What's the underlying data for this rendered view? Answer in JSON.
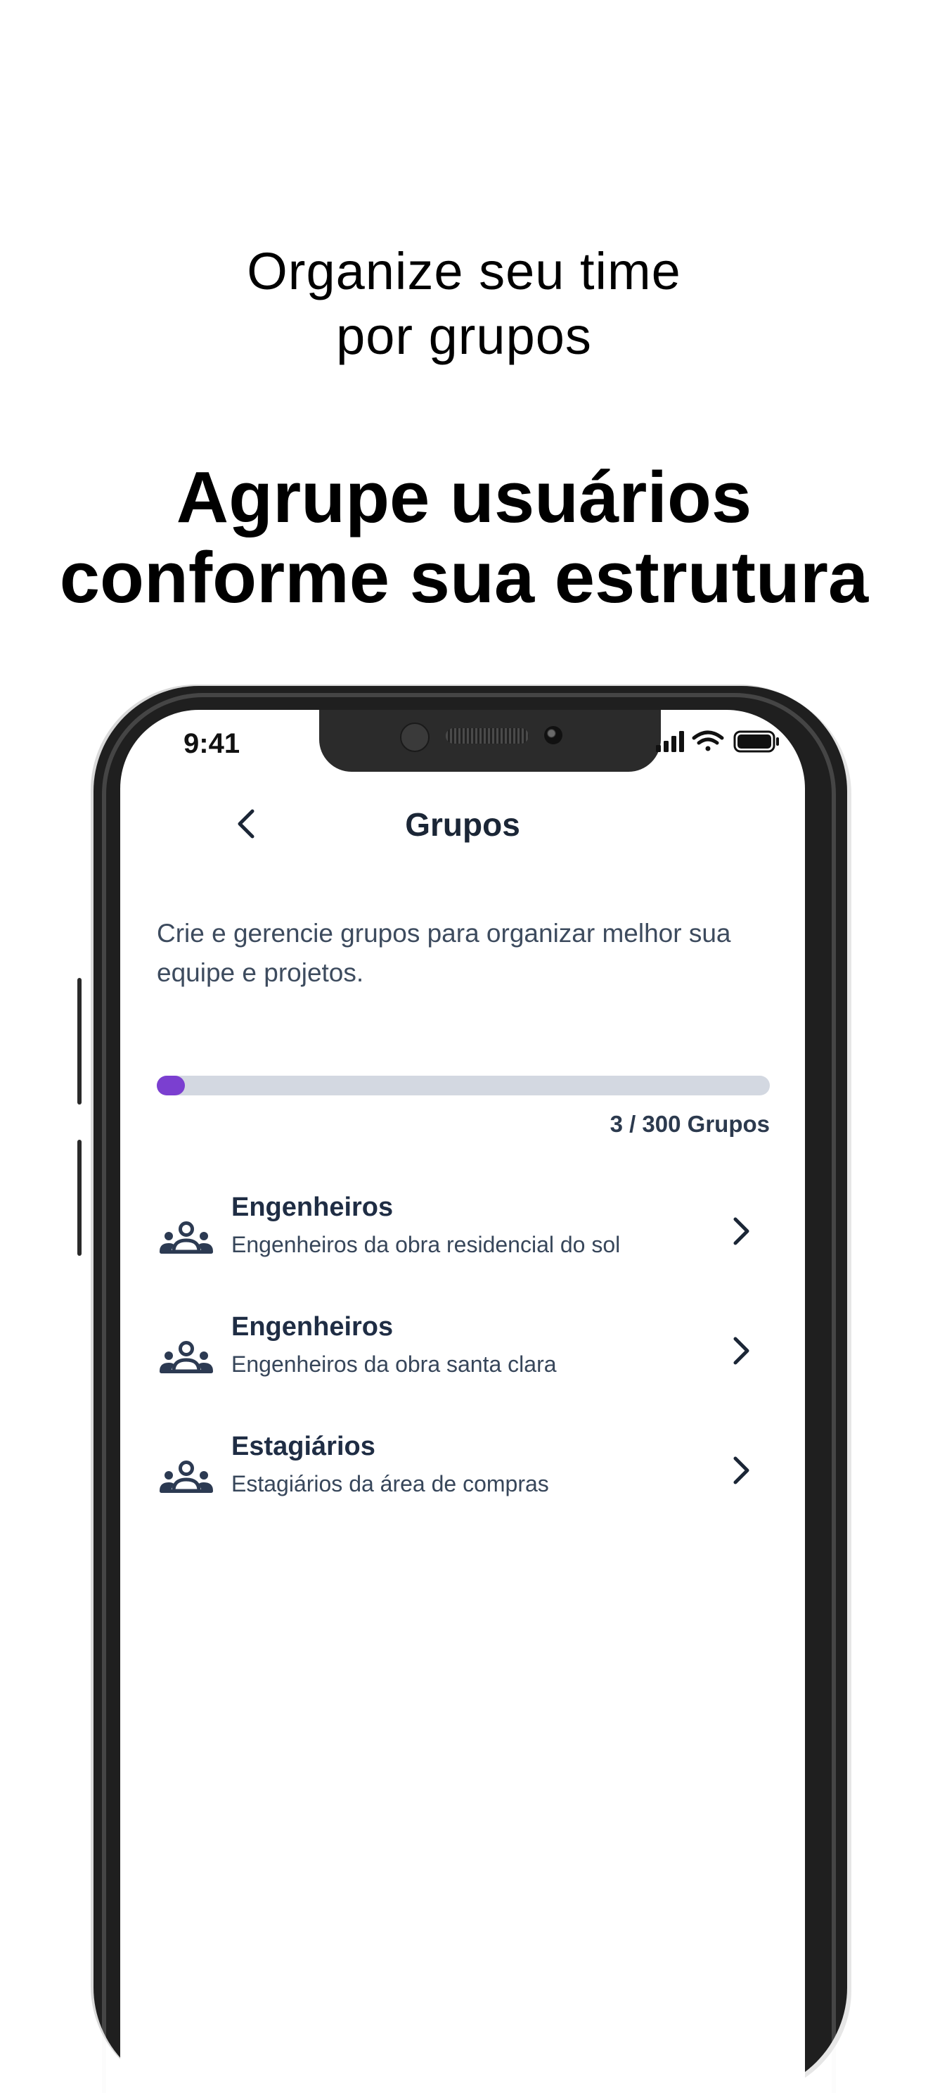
{
  "promo": {
    "subtitle_line1": "Organize seu time",
    "subtitle_line2": "por grupos",
    "headline_line1": "Agrupe usuários",
    "headline_line2": "conforme sua estrutura"
  },
  "status_bar": {
    "time": "9:41",
    "icons": [
      "signal-icon",
      "wifi-icon",
      "battery-icon"
    ]
  },
  "header": {
    "title": "Grupos",
    "back_icon": "chevron-left-icon"
  },
  "description": "Crie e gerencie grupos para organizar melhor sua equipe e projetos.",
  "usage": {
    "used": 3,
    "limit": 300,
    "label": "3 / 300 Grupos",
    "accent_color": "#7b3fd0",
    "track_color": "#d3d8e1"
  },
  "groups": [
    {
      "name": "Engenheiros",
      "description": "Engenheiros da obra residencial do sol",
      "icon": "users-group-icon"
    },
    {
      "name": "Engenheiros",
      "description": "Engenheiros da obra santa clara",
      "icon": "users-group-icon"
    },
    {
      "name": "Estagiários",
      "description": "Estagiários da área de compras",
      "icon": "users-group-icon"
    }
  ]
}
